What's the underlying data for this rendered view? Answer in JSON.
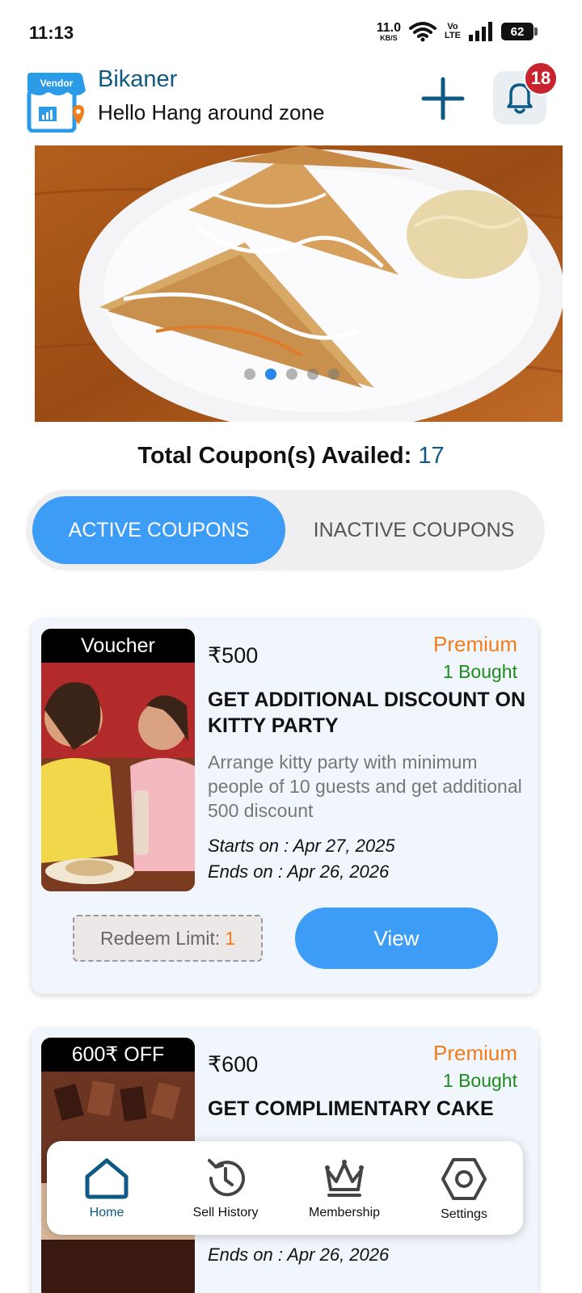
{
  "status_bar": {
    "time": "11:13",
    "net_speed_value": "11.0",
    "net_speed_unit": "KB/S",
    "volte": "Vo\nLTE",
    "battery": "62"
  },
  "header": {
    "logo_text": "Vendor",
    "city": "Bikaner",
    "greeting": "Hello Hang around zone",
    "notification_count": "18"
  },
  "banner": {
    "slide_count": 5,
    "active_slide": 1
  },
  "summary": {
    "total_label": "Total Coupon(s) Availed:",
    "total_value": "17"
  },
  "tabs": {
    "active": "ACTIVE COUPONS",
    "inactive": "INACTIVE COUPONS"
  },
  "coupons": [
    {
      "badge": "Voucher",
      "price": "₹500",
      "tier": "Premium",
      "bought": "1 Bought",
      "title": "GET  ADDITIONAL DISCOUNT ON KITTY PARTY",
      "description": "Arrange kitty party with minimum people of 10  guests and get additional 500 discount",
      "starts": "Starts on : Apr 27, 2025",
      "ends": "Ends on : Apr 26, 2026",
      "redeem_label": "Redeem Limit:",
      "redeem_value": "1",
      "view_label": "View"
    },
    {
      "badge": "600₹ OFF",
      "price": "₹600",
      "tier": "Premium",
      "bought": "1 Bought",
      "title": "GET COMPLIMENTARY CAKE",
      "ends": "Ends on : Apr 26, 2026"
    }
  ],
  "bottom_nav": [
    {
      "label": "Home",
      "icon": "home-icon"
    },
    {
      "label": "Sell History",
      "icon": "history-icon"
    },
    {
      "label": "Membership",
      "icon": "crown-icon"
    },
    {
      "label": "Settings",
      "icon": "settings-icon"
    }
  ],
  "colors": {
    "primary": "#3d9cf5",
    "brand_dark": "#0e5a85",
    "premium": "#f07d1a",
    "bought": "#1e8a1e",
    "badge_red": "#c8242f"
  }
}
